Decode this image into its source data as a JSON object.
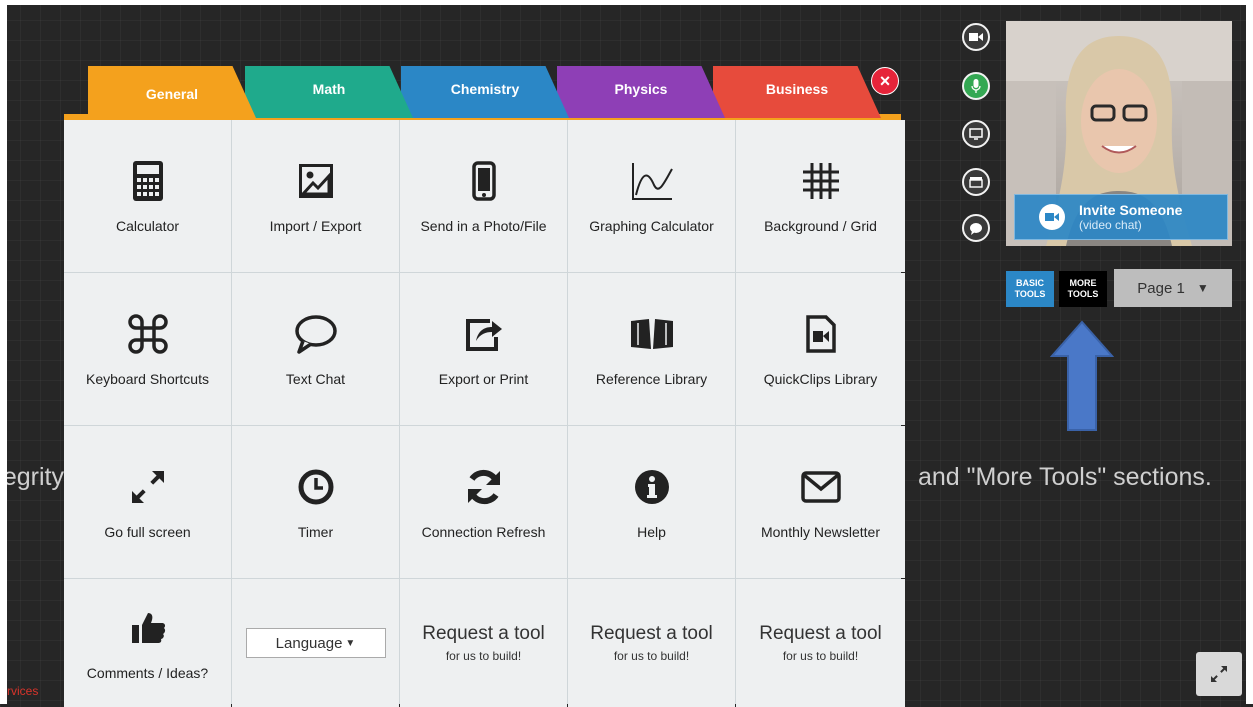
{
  "tabs": [
    {
      "label": "General"
    },
    {
      "label": "Math"
    },
    {
      "label": "Chemistry"
    },
    {
      "label": "Physics"
    },
    {
      "label": "Business"
    }
  ],
  "close_label": "×",
  "tools": [
    {
      "label": "Calculator",
      "icon": "calculator-icon"
    },
    {
      "label": "Import / Export",
      "icon": "image-icon"
    },
    {
      "label": "Send in a Photo/File",
      "icon": "phone-icon"
    },
    {
      "label": "Graphing Calculator",
      "icon": "graph-icon"
    },
    {
      "label": "Background / Grid",
      "icon": "grid-icon"
    },
    {
      "label": "Keyboard Shortcuts",
      "icon": "command-key-icon"
    },
    {
      "label": "Text Chat",
      "icon": "chat-bubble-icon"
    },
    {
      "label": "Export or Print",
      "icon": "share-icon"
    },
    {
      "label": "Reference Library",
      "icon": "book-icon"
    },
    {
      "label": "QuickClips Library",
      "icon": "video-file-icon"
    },
    {
      "label": "Go full screen",
      "icon": "expand-icon"
    },
    {
      "label": "Timer",
      "icon": "clock-icon"
    },
    {
      "label": "Connection Refresh",
      "icon": "refresh-icon"
    },
    {
      "label": "Help",
      "icon": "info-icon"
    },
    {
      "label": "Monthly Newsletter",
      "icon": "envelope-icon"
    },
    {
      "label": "Comments / Ideas?",
      "icon": "thumbs-up-icon"
    }
  ],
  "language": {
    "label": "Language"
  },
  "request": {
    "big": "Request a tool",
    "small": "for us to build!"
  },
  "background_text": {
    "left": "egrity",
    "right": "and \"More Tools\" sections."
  },
  "footer_link": "rvices",
  "invite": {
    "title": "Invite Someone",
    "subtitle": "(video chat)"
  },
  "basic_tools": {
    "line1": "BASIC",
    "line2": "TOOLS"
  },
  "more_tools": {
    "line1": "MORE",
    "line2": "TOOLS"
  },
  "page_select": {
    "value": "Page 1"
  },
  "colors": {
    "general": "#f4a11d",
    "math": "#1faa8c",
    "chemistry": "#2b87c6",
    "physics": "#8e3fb6",
    "business": "#e74b3c",
    "arrow": "#4a78c8"
  }
}
